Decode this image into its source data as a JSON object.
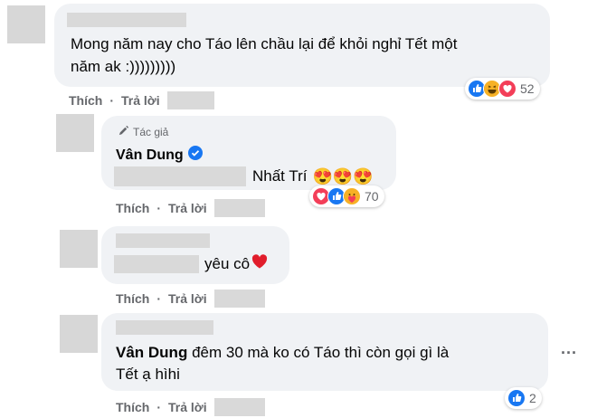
{
  "comments": [
    {
      "text": "Mong năm nay cho Táo lên chầu lại để khỏi nghỉ Tết một năm ak :)))))))))",
      "line1": "Mong năm nay cho Táo lên chầu lại để khỏi nghỉ Tết một",
      "line2": "năm ak :)))))))))",
      "like_label": "Thích",
      "reply_label": "Trả lời",
      "reaction_icons": [
        "like-icon",
        "haha-icon",
        "love-icon"
      ],
      "reaction_count": "52"
    },
    {
      "author_badge": "Tác giả",
      "author": "Vân Dung",
      "text_visible": "Nhất Trí",
      "emoji": "😍😍😍",
      "like_label": "Thích",
      "reply_label": "Trả lời",
      "reaction_icons": [
        "love-icon",
        "like-icon",
        "care-icon"
      ],
      "reaction_count": "70"
    },
    {
      "text_visible": "yêu cô",
      "emoji": "❤️",
      "like_label": "Thích",
      "reply_label": "Trả lời"
    },
    {
      "author": "Vân Dung",
      "line1": "đêm 30 mà ko có Táo thì còn gọi gì là",
      "line2": "Tết ạ hìhi",
      "like_label": "Thích",
      "reply_label": "Trả lời",
      "reaction_icons": [
        "like-icon"
      ],
      "reaction_count": "2",
      "more_options": "···"
    }
  ],
  "colors": {
    "bubble": "#f0f2f5",
    "like_blue": "#1877f2",
    "love_red": "#f33e58",
    "haha_yellow": "#f7b125",
    "secondary_text": "#65676b"
  }
}
